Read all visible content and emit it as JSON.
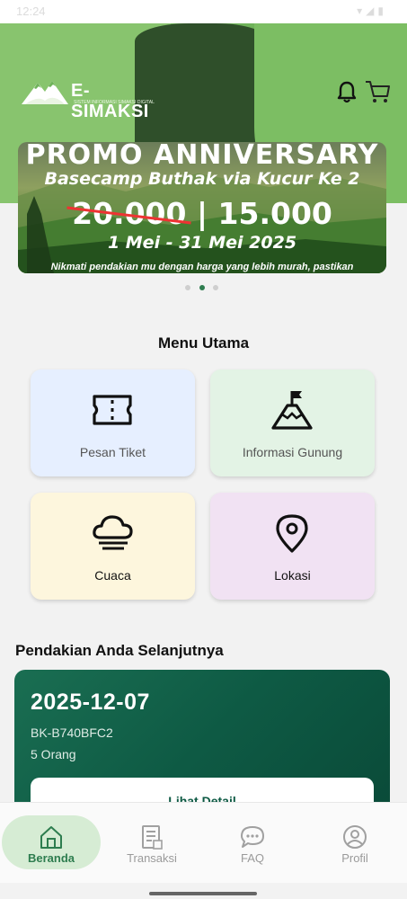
{
  "status_bar": {
    "time": "12:24"
  },
  "header": {
    "logo_text": "E-SIMAKSI",
    "logo_subtitle": "SISTEM INFORMASI SIMAKSI DIGITAL"
  },
  "banner": {
    "title": "PROMO ANNIVERSARY",
    "subtitle": "Basecamp Buthak via Kucur Ke 2",
    "old_price": "20.000",
    "separator": "|",
    "new_price": "15.000",
    "date_range": "1 Mei - 31 Mei 2025",
    "description": "Nikmati pendakian mu dengan harga yang lebih murah, pastikan",
    "active_slide": 2,
    "slide_count": 3
  },
  "menu": {
    "title": "Menu Utama",
    "items": [
      {
        "label": "Pesan Tiket",
        "icon": "ticket-icon",
        "color": "#e6efff"
      },
      {
        "label": "Informasi Gunung",
        "icon": "mountain-flag-icon",
        "color": "#e3f3e5"
      },
      {
        "label": "Cuaca",
        "icon": "cloud-fog-icon",
        "color": "#fdf6dd"
      },
      {
        "label": "Lokasi",
        "icon": "location-pin-icon",
        "color": "#f1e2f3"
      }
    ]
  },
  "next_trip": {
    "title": "Pendakian Anda Selanjutnya",
    "date": "2025-12-07",
    "booking_code": "BK-B740BFC2",
    "people": "5 Orang",
    "button_label": "Lihat Detail"
  },
  "bottom_nav": {
    "items": [
      {
        "label": "Beranda",
        "icon": "home-icon",
        "active": true
      },
      {
        "label": "Transaksi",
        "icon": "receipt-icon",
        "active": false
      },
      {
        "label": "FAQ",
        "icon": "chat-bubble-icon",
        "active": false
      },
      {
        "label": "Profil",
        "icon": "user-icon",
        "active": false
      }
    ]
  },
  "colors": {
    "header_green": "#6fb35a",
    "primary_dark_green": "#0e5a44",
    "active_nav": "#2e7d4f"
  }
}
